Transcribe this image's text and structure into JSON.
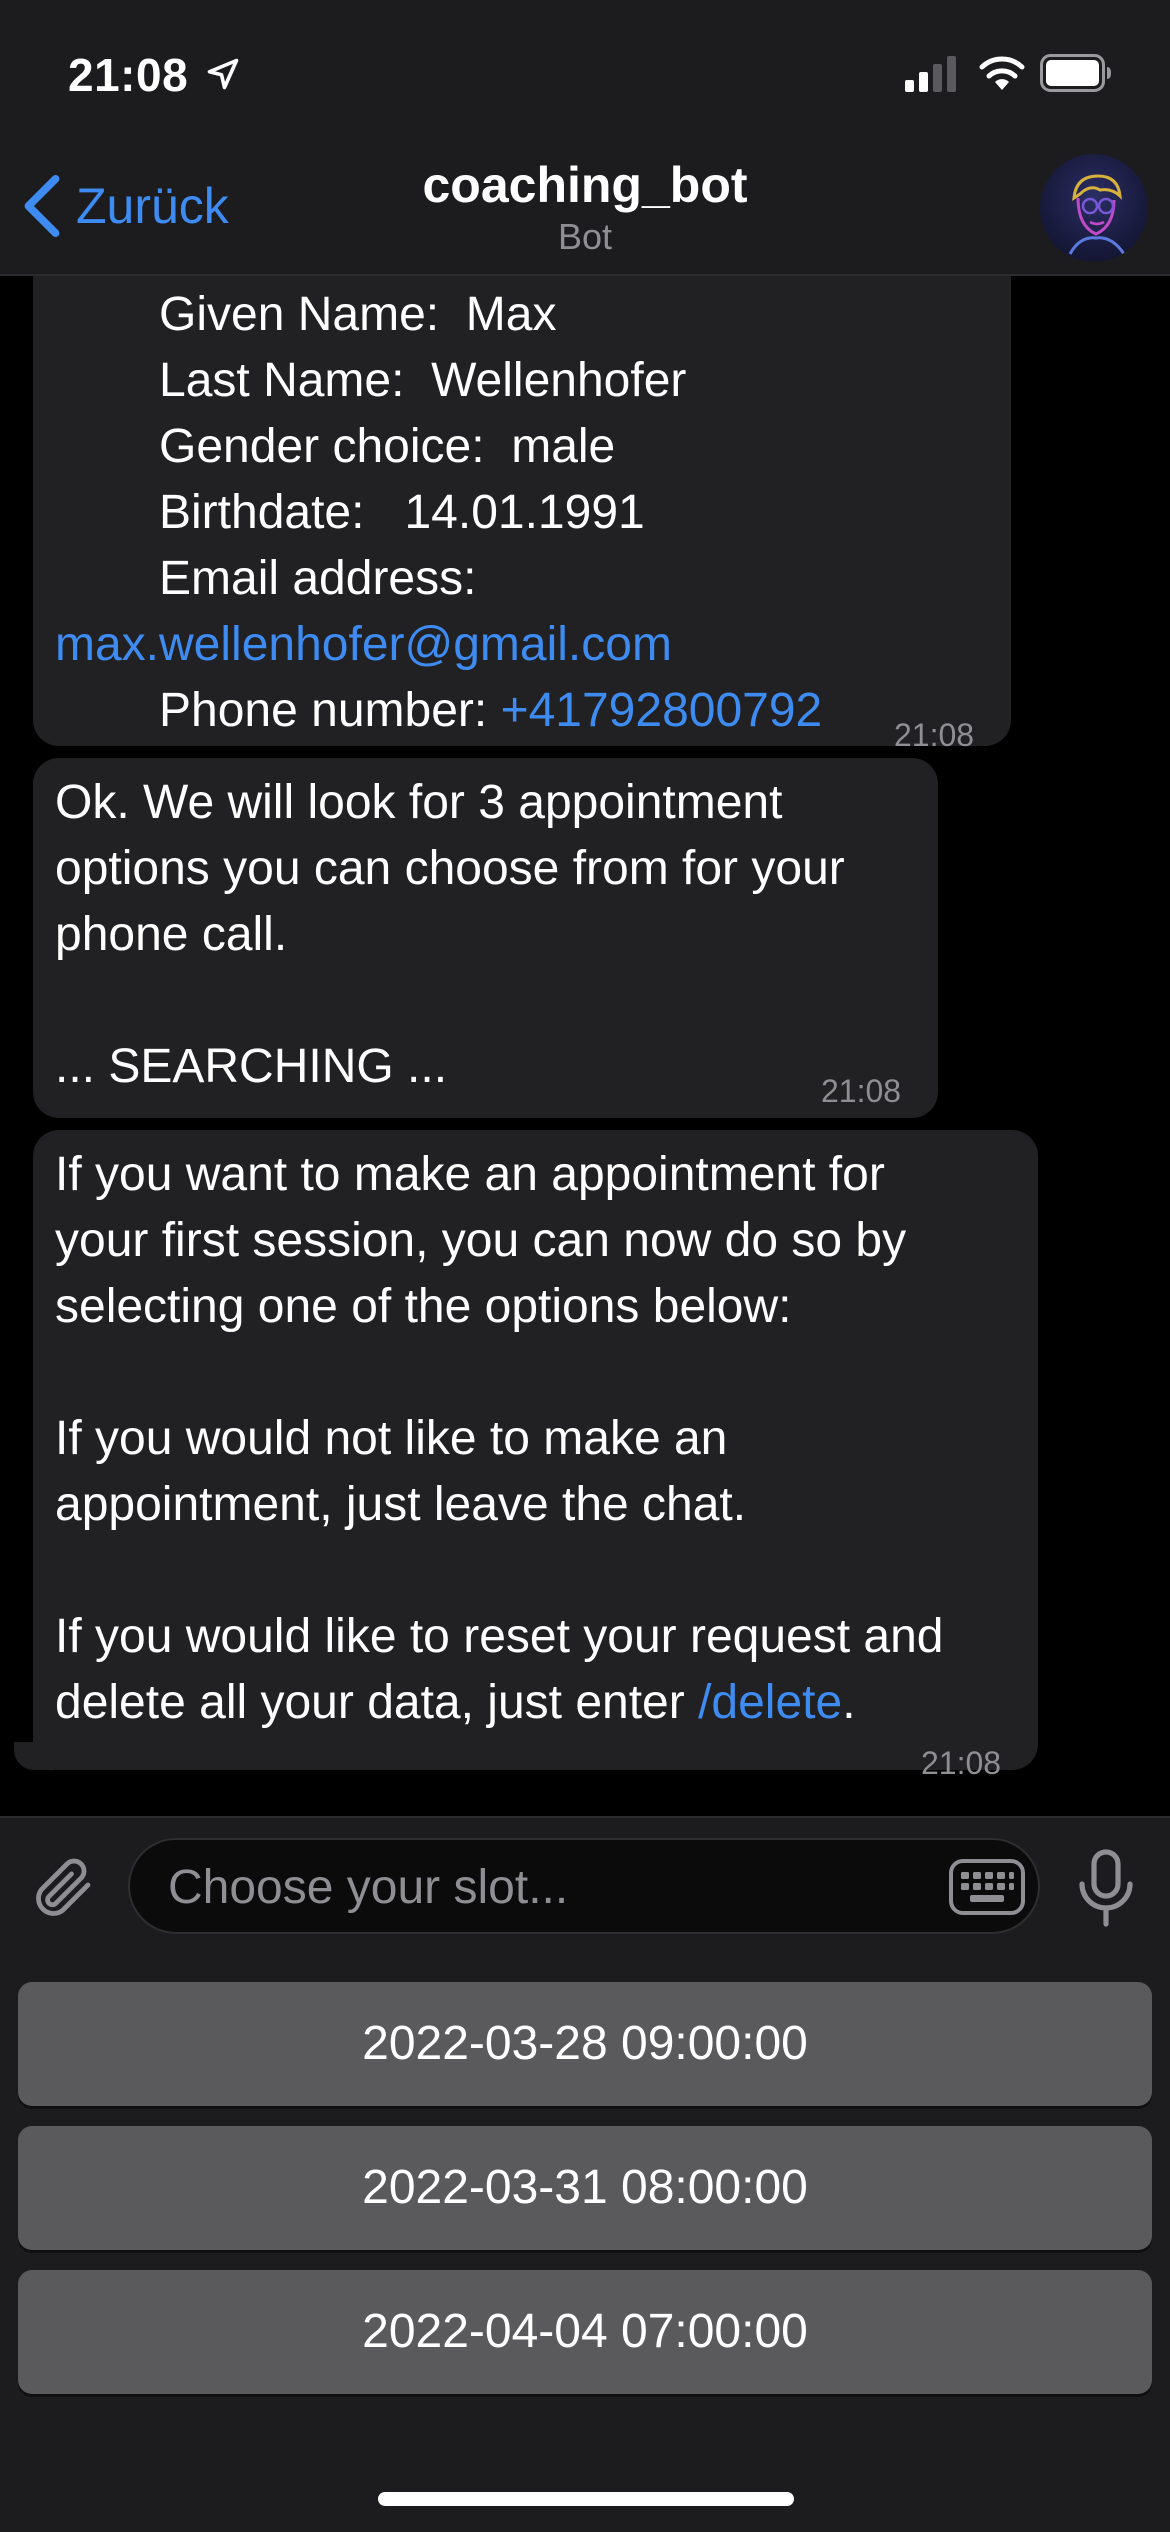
{
  "status_bar": {
    "time": "21:08"
  },
  "nav": {
    "back_label": "Zurück",
    "title": "coaching_bot",
    "subtitle": "Bot"
  },
  "messages": [
    {
      "fields": [
        {
          "label": "Given Name:",
          "value": "Max"
        },
        {
          "label": "Last Name:",
          "value": "Wellenhofer"
        },
        {
          "label": "Gender choice:",
          "value": "male"
        },
        {
          "label": "Birthdate:",
          "value": "14.01.1991"
        },
        {
          "label": "Email address:",
          "value": "max.wellenhofer@gmail.com"
        },
        {
          "label": "Phone number:",
          "value": "+41792800792"
        }
      ],
      "time": "21:08"
    },
    {
      "lines": [
        "Ok. We will look for 3 appointment",
        "options you can choose from for your",
        "phone call.",
        "... SEARCHING ..."
      ],
      "time": "21:08"
    },
    {
      "lines": [
        "If you want to make an appointment for",
        "your first session, you can now do so by",
        "selecting one of the options below:",
        "If you would not like to make an",
        "appointment, just leave the chat.",
        "If you would like to reset your request and",
        "delete all your data, just enter"
      ],
      "command": "/delete",
      "trailing": ".",
      "time": "21:08"
    }
  ],
  "input": {
    "placeholder": "Choose your slot..."
  },
  "reply_options": [
    "2022-03-28 09:00:00",
    "2022-03-31 08:00:00",
    "2022-04-04 07:00:00"
  ],
  "colors": {
    "accent": "#3e8bf1",
    "bubble": "#212123",
    "bar": "#1c1c1e",
    "reply_button": "#5a5a5c"
  },
  "icons": [
    "location-arrow-icon",
    "signal-icon",
    "wifi-icon",
    "battery-icon",
    "chevron-left-icon",
    "paperclip-icon",
    "keyboard-icon",
    "microphone-icon"
  ]
}
